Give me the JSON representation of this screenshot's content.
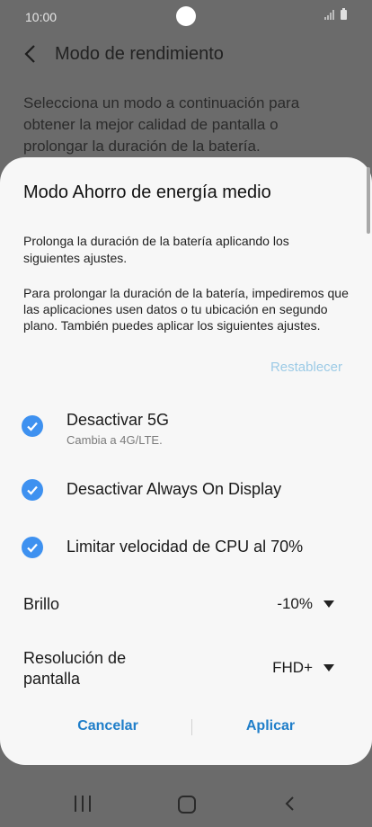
{
  "status_bar": {
    "time": "10:00"
  },
  "header": {
    "title": "Modo de rendimiento"
  },
  "background": {
    "description": "Selecciona un modo a continuación para obtener la mejor calidad de pantalla o prolongar la duración de la batería."
  },
  "dialog": {
    "title": "Modo Ahorro de energía medio",
    "paragraph1": "Prolonga la duración de la batería aplicando los siguientes ajustes.",
    "paragraph2": "Para prolongar la duración de la batería, impediremos que las aplicaciones usen datos o tu ubicación en segundo plano. También puedes aplicar los siguientes ajustes.",
    "reset_label": "Restablecer",
    "options": [
      {
        "label": "Desactivar 5G",
        "sublabel": "Cambia a 4G/LTE.",
        "checked": true
      },
      {
        "label": "Desactivar Always On Display",
        "checked": true
      },
      {
        "label": "Limitar velocidad de CPU al 70%",
        "checked": true
      }
    ],
    "brightness": {
      "label": "Brillo",
      "value": "-10%"
    },
    "resolution": {
      "label_line1": "Resolución de",
      "label_line2": "pantalla",
      "value": "FHD+"
    },
    "cancel_label": "Cancelar",
    "apply_label": "Aplicar"
  },
  "colors": {
    "accent": "#3e91f0",
    "button_text": "#1f7ec9",
    "reset_link": "#9ccbe6"
  }
}
